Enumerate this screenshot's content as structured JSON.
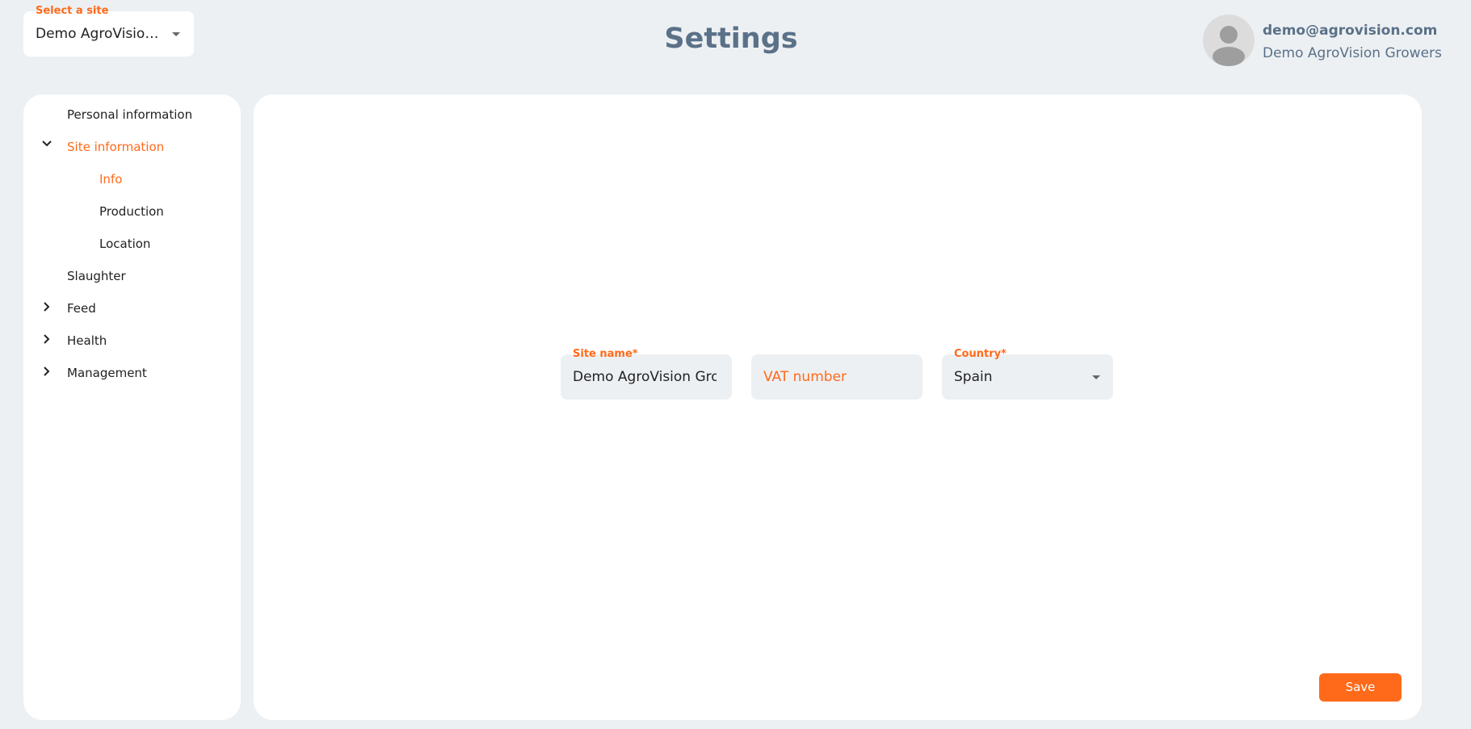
{
  "site_select": {
    "label": "Select a site",
    "value": "Demo AgroVision ..."
  },
  "page_title": "Settings",
  "user": {
    "email": "demo@agrovision.com",
    "organization": "Demo AgroVision Growers"
  },
  "sidebar": {
    "items": [
      {
        "label": "Personal information"
      },
      {
        "label": "Site information",
        "expanded": true,
        "active": true
      },
      {
        "label": "Info",
        "active": true
      },
      {
        "label": "Production"
      },
      {
        "label": "Location"
      },
      {
        "label": "Slaughter"
      },
      {
        "label": "Feed",
        "expanded": false
      },
      {
        "label": "Health",
        "expanded": false
      },
      {
        "label": "Management",
        "expanded": false
      }
    ]
  },
  "form": {
    "site_name": {
      "label": "Site name*",
      "value": "Demo AgroVision Gro"
    },
    "vat_number": {
      "placeholder": "VAT number"
    },
    "country": {
      "label": "Country*",
      "value": "Spain"
    }
  },
  "save_label": "Save",
  "colors": {
    "accent": "#ff6a1a",
    "title": "#5a7188",
    "background": "#edf0f3"
  },
  "icons": [
    "chevron-down-icon",
    "chevron-right-icon",
    "user-avatar-icon",
    "dropdown-caret-icon"
  ]
}
